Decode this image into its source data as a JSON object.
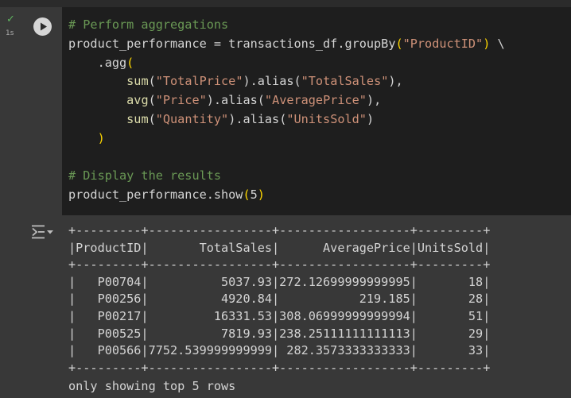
{
  "cell": {
    "status": "✓",
    "exec_time": "1s",
    "run_button_icon": "play-icon",
    "output_icon": "output-options-icon",
    "code": [
      [
        {
          "t": "# Perform aggregations",
          "c": "cmt"
        }
      ],
      [
        {
          "t": "product_performance = transactions_df.groupBy",
          "c": "pl"
        },
        {
          "t": "(",
          "c": "pn"
        },
        {
          "t": "\"ProductID\"",
          "c": "str"
        },
        {
          "t": ")",
          "c": "pn"
        },
        {
          "t": " \\",
          "c": "pl"
        }
      ],
      [
        {
          "t": "    .agg",
          "c": "pl"
        },
        {
          "t": "(",
          "c": "pn"
        }
      ],
      [
        {
          "t": "        ",
          "c": "pl"
        },
        {
          "t": "sum",
          "c": "fn"
        },
        {
          "t": "(",
          "c": "pl"
        },
        {
          "t": "\"TotalPrice\"",
          "c": "str"
        },
        {
          "t": ").alias(",
          "c": "pl"
        },
        {
          "t": "\"TotalSales\"",
          "c": "str"
        },
        {
          "t": "),",
          "c": "pl"
        }
      ],
      [
        {
          "t": "        ",
          "c": "pl"
        },
        {
          "t": "avg",
          "c": "fn"
        },
        {
          "t": "(",
          "c": "pl"
        },
        {
          "t": "\"Price\"",
          "c": "str"
        },
        {
          "t": ").alias(",
          "c": "pl"
        },
        {
          "t": "\"AveragePrice\"",
          "c": "str"
        },
        {
          "t": "),",
          "c": "pl"
        }
      ],
      [
        {
          "t": "        ",
          "c": "pl"
        },
        {
          "t": "sum",
          "c": "fn"
        },
        {
          "t": "(",
          "c": "pl"
        },
        {
          "t": "\"Quantity\"",
          "c": "str"
        },
        {
          "t": ").alias(",
          "c": "pl"
        },
        {
          "t": "\"UnitsSold\"",
          "c": "str"
        },
        {
          "t": ")",
          "c": "pl"
        }
      ],
      [
        {
          "t": "    ",
          "c": "pl"
        },
        {
          "t": ")",
          "c": "pn"
        }
      ],
      [
        {
          "t": "",
          "c": "pl"
        }
      ],
      [
        {
          "t": "# Display the results",
          "c": "cmt"
        }
      ],
      [
        {
          "t": "product_performance.show",
          "c": "pl"
        },
        {
          "t": "(",
          "c": "pn"
        },
        {
          "t": "5",
          "c": "pl"
        },
        {
          "t": ")",
          "c": "pn"
        }
      ]
    ]
  },
  "output": {
    "border": "+---------+-----------------+------------------+---------+",
    "header_line": "|ProductID|       TotalSales|      AveragePrice|UnitsSold|",
    "columns": [
      "ProductID",
      "TotalSales",
      "AveragePrice",
      "UnitsSold"
    ],
    "rows": [
      {
        "line": "|   P00704|          5037.93|272.12699999999995|       18|",
        "cells": [
          "P00704",
          "5037.93",
          "272.12699999999995",
          "18"
        ]
      },
      {
        "line": "|   P00256|          4920.84|           219.185|       28|",
        "cells": [
          "P00256",
          "4920.84",
          "219.185",
          "28"
        ]
      },
      {
        "line": "|   P00217|         16331.53|308.06999999999994|       51|",
        "cells": [
          "P00217",
          "16331.53",
          "308.06999999999994",
          "51"
        ]
      },
      {
        "line": "|   P00525|          7819.93|238.25111111111113|       29|",
        "cells": [
          "P00525",
          "7819.93",
          "238.25111111111113",
          "29"
        ]
      },
      {
        "line": "|   P00566|7752.539999999999| 282.3573333333333|       33|",
        "cells": [
          "P00566",
          "7752.539999999999",
          "282.3573333333333",
          "33"
        ]
      }
    ],
    "footer": "only showing top 5 rows"
  },
  "colors": {
    "comment": "#6a9955",
    "string": "#ce9178",
    "function": "#dcdcaa",
    "paren": "#ffd700",
    "text": "#d4d4d4",
    "code_background": "#1e1e1e",
    "output_background": "#383838",
    "success": "#5fb35f"
  }
}
